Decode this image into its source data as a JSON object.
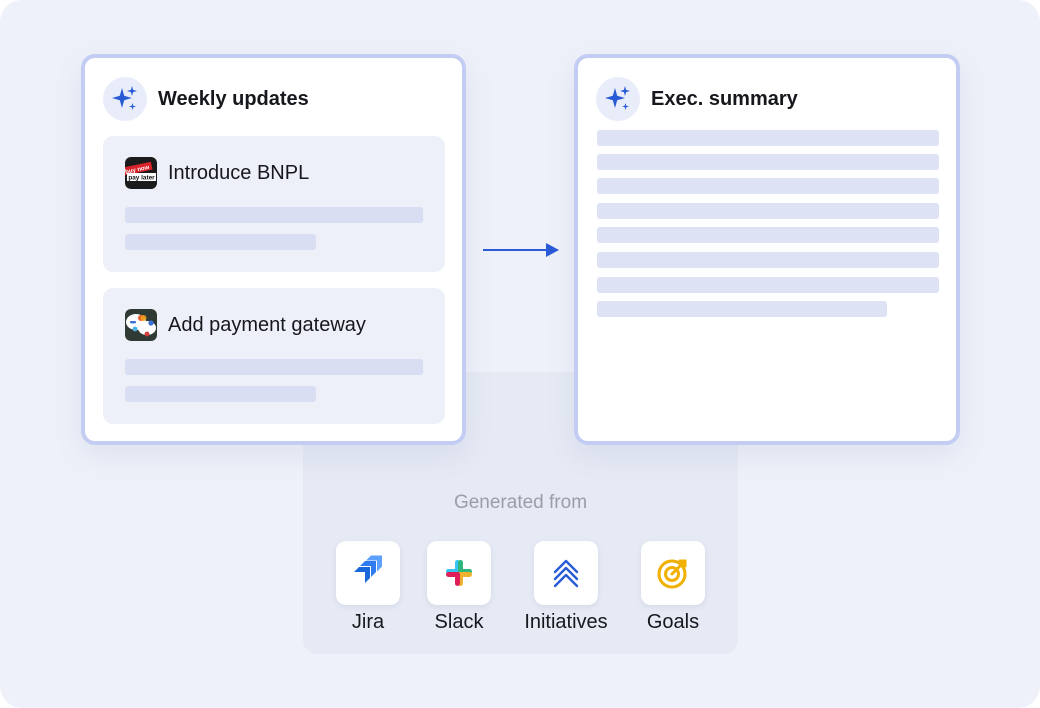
{
  "weekly_card": {
    "title": "Weekly updates",
    "icon": "sparkles-icon",
    "items": [
      {
        "title": "Introduce BNPL",
        "icon": "buy-now-pay-later-logo",
        "logo_text_top": "buy now",
        "logo_text_bottom": "pay later"
      },
      {
        "title": "Add payment gateway",
        "icon": "payment-gateway-logo"
      }
    ]
  },
  "summary_card": {
    "title": "Exec. summary",
    "icon": "sparkles-icon"
  },
  "sources": {
    "label": "Generated from",
    "items": [
      {
        "label": "Jira",
        "icon": "jira-icon"
      },
      {
        "label": "Slack",
        "icon": "slack-icon"
      },
      {
        "label": "Initiatives",
        "icon": "initiatives-icon"
      },
      {
        "label": "Goals",
        "icon": "goals-icon"
      }
    ]
  },
  "colors": {
    "accent": "#2a5bd7",
    "card_border": "#c3cdf3",
    "background": "#eef1f9",
    "goals": "#f1b000"
  }
}
